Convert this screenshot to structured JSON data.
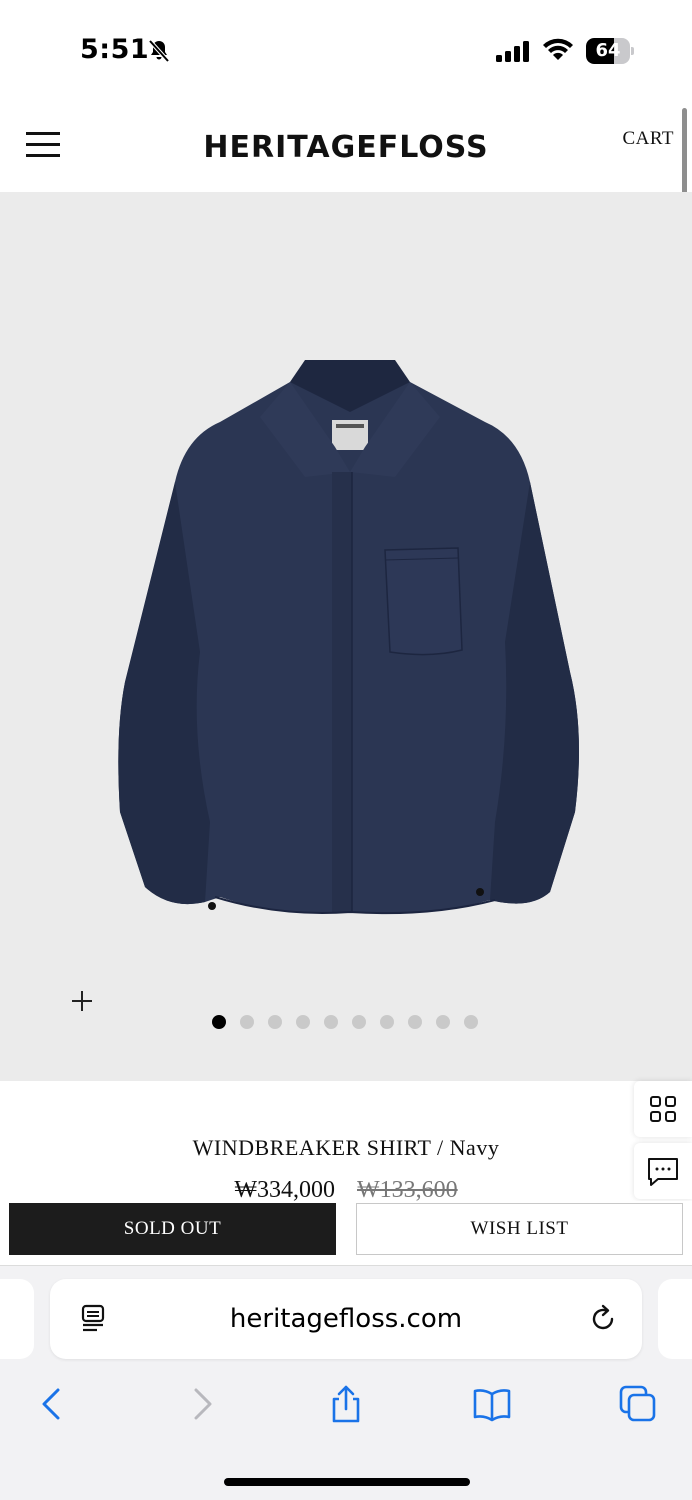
{
  "status_bar": {
    "time": "5:51",
    "battery_level": "64",
    "battery_fraction": 0.64,
    "icons": [
      "bell-slash-icon",
      "cellular-signal-icon",
      "wifi-icon",
      "battery-icon"
    ]
  },
  "header": {
    "brand": "HERITAGEFLOSS",
    "cart_label": "CART",
    "menu_icon": "hamburger-menu-icon"
  },
  "gallery": {
    "image_description_icon": "product-photo",
    "zoom_icon": "plus-icon",
    "slide_count": 10,
    "active_slide": 1
  },
  "product": {
    "name": "WINDBREAKER SHIRT / Navy",
    "price": "₩334,000",
    "sale_price": "₩133,600"
  },
  "actions": {
    "sold_out_label": "SOLD OUT",
    "wish_list_label": "WISH LIST"
  },
  "side_widgets": {
    "icons": [
      "grid-icon",
      "chat-icon"
    ]
  },
  "browser": {
    "url": "heritagefloss.com",
    "icons": [
      "reader-icon",
      "reload-icon",
      "back-icon",
      "forward-icon",
      "share-icon",
      "bookmarks-icon",
      "tabs-icon"
    ]
  },
  "colors": {
    "shirt_navy": "#27334f",
    "image_bg": "#ebebeb",
    "sold_out_bg": "#1c1c1c",
    "ios_blue": "#1a73e8"
  }
}
